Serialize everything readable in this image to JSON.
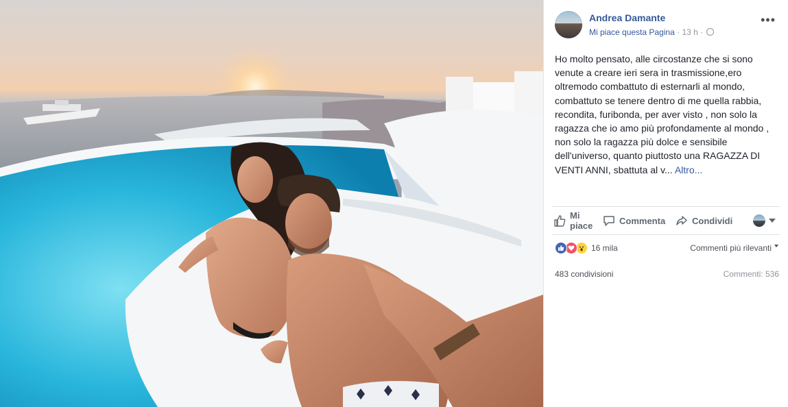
{
  "post": {
    "author": "Andrea Damante",
    "like_page": "Mi piace questa Pagina",
    "separator": "·",
    "time": "13 h",
    "more_icon": "ellipsis-icon",
    "text": "Ho molto pensato, alle circostanze che si sono venute a creare ieri sera in trasmissione,ero oltremodo combattuto di esternarli al mondo, combattuto se tenere dentro di me quella rabbia, recondita, furibonda, per aver visto , non solo la ragazza che io amo più profondamente al mondo , non solo la ragazza più dolce e sensibile dell'universo, quanto piuttosto una RAGAZZA DI VENTI ANNI, sbattuta al v...",
    "more_link": "Altro..."
  },
  "actions": {
    "like_line1": "Mi",
    "like_line2": "piace",
    "comment": "Commenta",
    "share": "Condividi"
  },
  "stats": {
    "reactions_count": "16 mila",
    "sort_label": "Commenti più rilevanti",
    "shares": "483 condivisioni",
    "comments": "Commenti: 536"
  },
  "colors": {
    "link": "#365899",
    "like": "#4267b2",
    "love": "#f25268",
    "wow": "#fcd240"
  }
}
